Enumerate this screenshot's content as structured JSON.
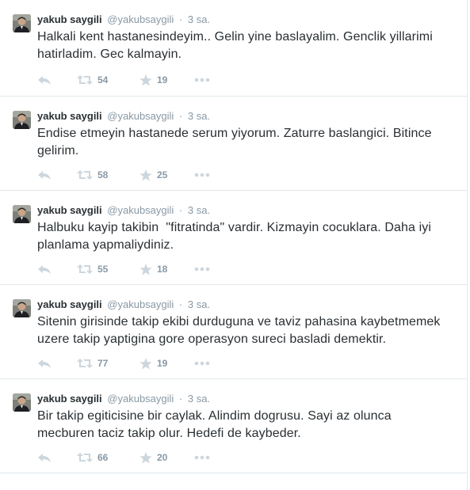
{
  "tweets": [
    {
      "fullname": "yakub saygili",
      "username": "@yakubsaygili",
      "separator": "·",
      "time": "3 sa.",
      "text_lines": [
        "Halkali kent hastanesindeyim.. Gelin yine baslayalim. Genclik yillarimi",
        "hatirladim. Gec kalmayin."
      ],
      "retweets": "54",
      "favorites": "19"
    },
    {
      "fullname": "yakub saygili",
      "username": "@yakubsaygili",
      "separator": "·",
      "time": "3 sa.",
      "text_lines": [
        "Endise etmeyin hastanede serum yiyorum. Zaturre baslangici. Bitince",
        "gelirim."
      ],
      "retweets": "58",
      "favorites": "25"
    },
    {
      "fullname": "yakub saygili",
      "username": "@yakubsaygili",
      "separator": "·",
      "time": "3 sa.",
      "text_lines": [
        "Halbuku kayip takibin  \"fitratinda\" vardir. Kizmayin cocuklara. Daha iyi",
        "planlama yapmaliydiniz."
      ],
      "retweets": "55",
      "favorites": "18"
    },
    {
      "fullname": "yakub saygili",
      "username": "@yakubsaygili",
      "separator": "·",
      "time": "3 sa.",
      "text_lines": [
        "Sitenin girisinde takip ekibi durduguna ve taviz pahasina kaybetmemek",
        "uzere takip yaptigina gore operasyon sureci basladi demektir."
      ],
      "retweets": "77",
      "favorites": "19"
    },
    {
      "fullname": "yakub saygili",
      "username": "@yakubsaygili",
      "separator": "·",
      "time": "3 sa.",
      "text_lines": [
        "Bir takip egiticisine bir caylak. Alindim dogrusu. Sayi az olunca",
        "mecburen taciz takip olur. Hedefi de kaybeder."
      ],
      "retweets": "66",
      "favorites": "20"
    }
  ],
  "icons": {
    "reply": "reply-icon",
    "retweet": "retweet-icon",
    "favorite": "star-icon",
    "more": "more-dots-icon"
  },
  "colors": {
    "text": "#292f33",
    "muted": "#8899a6",
    "icon": "#ccd6dd",
    "border": "#e1e8ed"
  }
}
